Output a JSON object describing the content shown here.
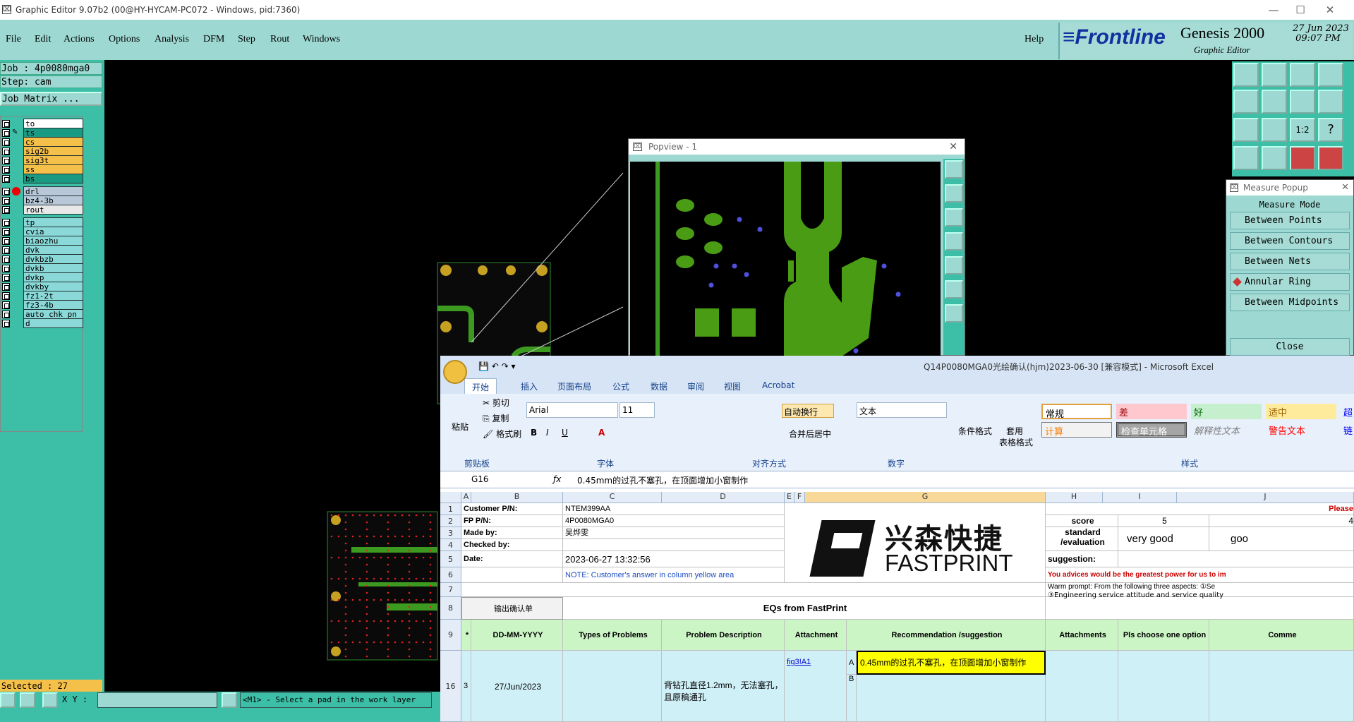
{
  "window": {
    "title": "Graphic Editor 9.07b2 (00@HY-HYCAM-PC072 - Windows, pid:7360)"
  },
  "menu": [
    {
      "label": "File"
    },
    {
      "label": "Edit"
    },
    {
      "label": "Actions"
    },
    {
      "label": "Options"
    },
    {
      "label": "Analysis"
    },
    {
      "label": "DFM"
    },
    {
      "label": "Step"
    },
    {
      "label": "Rout"
    },
    {
      "label": "Windows"
    }
  ],
  "help": "Help",
  "brand": {
    "logo": "Frontline",
    "product": "Genesis 2000",
    "sub": "Graphic Editor",
    "date": "27 Jun 2023",
    "time": "09:07 PM"
  },
  "job": {
    "job": "Job : 4p0080mga0",
    "step": "Step: cam",
    "matrix": "Job Matrix ..."
  },
  "layers": [
    {
      "name": "to",
      "color": "#ffffff"
    },
    {
      "name": "ts",
      "color": "#1a9a82"
    },
    {
      "name": "cs",
      "color": "#f5c04a"
    },
    {
      "name": "sig2b",
      "color": "#f5c04a"
    },
    {
      "name": "sig3t",
      "color": "#f5c04a"
    },
    {
      "name": "ss",
      "color": "#f5c04a"
    },
    {
      "name": "bs",
      "color": "#1a9a82"
    },
    {
      "name": "drl",
      "color": "#b8c8d8"
    },
    {
      "name": "bz4-3b",
      "color": "#b8c8d8"
    },
    {
      "name": "rout",
      "color": "#e8e8e8"
    },
    {
      "name": "tp",
      "color": "#8ad8d8"
    },
    {
      "name": "cvia",
      "color": "#8ad8d8"
    },
    {
      "name": "biaozhu",
      "color": "#8ad8d8"
    },
    {
      "name": "dvk",
      "color": "#8ad8d8"
    },
    {
      "name": "dvkbzb",
      "color": "#8ad8d8"
    },
    {
      "name": "dvkb",
      "color": "#8ad8d8"
    },
    {
      "name": "dvkp",
      "color": "#8ad8d8"
    },
    {
      "name": "dvkby",
      "color": "#8ad8d8"
    },
    {
      "name": "fz1-2t",
      "color": "#8ad8d8"
    },
    {
      "name": "fz3-4b",
      "color": "#8ad8d8"
    },
    {
      "name": "auto_chk_pn",
      "color": "#8ad8d8"
    },
    {
      "name": "d",
      "color": "#8ad8d8"
    }
  ],
  "status": {
    "selected": "Selected : 27",
    "xy_label": "X Y :",
    "hint": "<M1> - Select a pad in the work layer"
  },
  "popview": {
    "title": "Popview - 1"
  },
  "measure": {
    "title": "Measure Popup",
    "mode_label": "Measure Mode",
    "modes": [
      "Between Points",
      "Between Contours",
      "Between Nets",
      "Annular Ring",
      "Between Midpoints"
    ],
    "close": "Close"
  },
  "excel": {
    "title": "Q14P0080MGA0光绘确认(hjm)2023-06-30  [兼容模式] - Microsoft Excel",
    "tabs": [
      "开始",
      "插入",
      "页面布局",
      "公式",
      "数据",
      "审阅",
      "视图",
      "Acrobat"
    ],
    "clipboard": {
      "paste": "粘贴",
      "cut": "剪切",
      "copy": "复制",
      "format_painter": "格式刷",
      "group": "剪贴板"
    },
    "font": {
      "name": "Arial",
      "size": "11",
      "group": "字体"
    },
    "align": {
      "wrap": "自动换行",
      "merge": "合并后居中",
      "group": "对齐方式"
    },
    "number": {
      "format": "文本",
      "group": "数字"
    },
    "styles": {
      "cond": "条件格式",
      "table1": "套用",
      "table2": "表格格式",
      "normal": "常规",
      "bad": "差",
      "good": "好",
      "neutral": "适中",
      "hyper": "超",
      "calc": "计算",
      "check": "检查单元格",
      "explain": "解释性文本",
      "warn": "警告文本",
      "link": "链",
      "group": "样式"
    },
    "namebox": "G16",
    "formula": "0.45mm的过孔不塞孔，在顶面增加小窗制作",
    "cols": [
      "A",
      "B",
      "C",
      "D",
      "E",
      "F",
      "G",
      "H",
      "I",
      "J"
    ],
    "rows": [
      "1",
      "2",
      "3",
      "4",
      "5",
      "6",
      "7",
      "8",
      "9",
      "16"
    ],
    "labels": {
      "customer_pn": "Customer P/N:",
      "customer_pn_val": "NTEM399AA",
      "fp_pn": "FP P/N:",
      "fp_pn_val": "4P0080MGA0",
      "made_by": "Made by:",
      "made_by_val": "吴烨雯",
      "checked_by": "Checked by:",
      "date": "Date:",
      "date_val": "2023-06-27 13:32:56",
      "note": "NOTE: Customer's  answer in column yellow area",
      "logo_cn": "兴森快捷",
      "logo_en": "FASTPRINT",
      "please": "Please",
      "score": "score",
      "score5": "5",
      "score4": "4",
      "standard": "standard /evaluation",
      "very_good": "very good",
      "goo": "goo",
      "suggestion": "suggestion:",
      "advice": "You advices would be the greatest power for us to im",
      "warm": "Warm prompt:  From the following three aspects: ①Se",
      "eng": "③Engineering service attitude and service quality",
      "confirm": "输出确认单",
      "eqs": "EQs from FastPrint",
      "star": "*",
      "dd": "DD-MM-YYYY",
      "types": "Types of Problems",
      "problem": "Problem Description",
      "attach": "Attachment",
      "recom": "Recommendation /suggestion",
      "attachments": "Attachments",
      "pls": "Pls choose one option",
      "comm": "Comme",
      "r16_no": "3",
      "r16_date": "27/Jun/2023",
      "r16_desc": "背钻孔直径1.2mm，无法塞孔，且原稿通孔",
      "r16_link": "fig3!A1",
      "r16_a": "A",
      "r16_b": "B",
      "r16_recom": "0.45mm的过孔不塞孔，在顶面增加小窗制作"
    }
  }
}
